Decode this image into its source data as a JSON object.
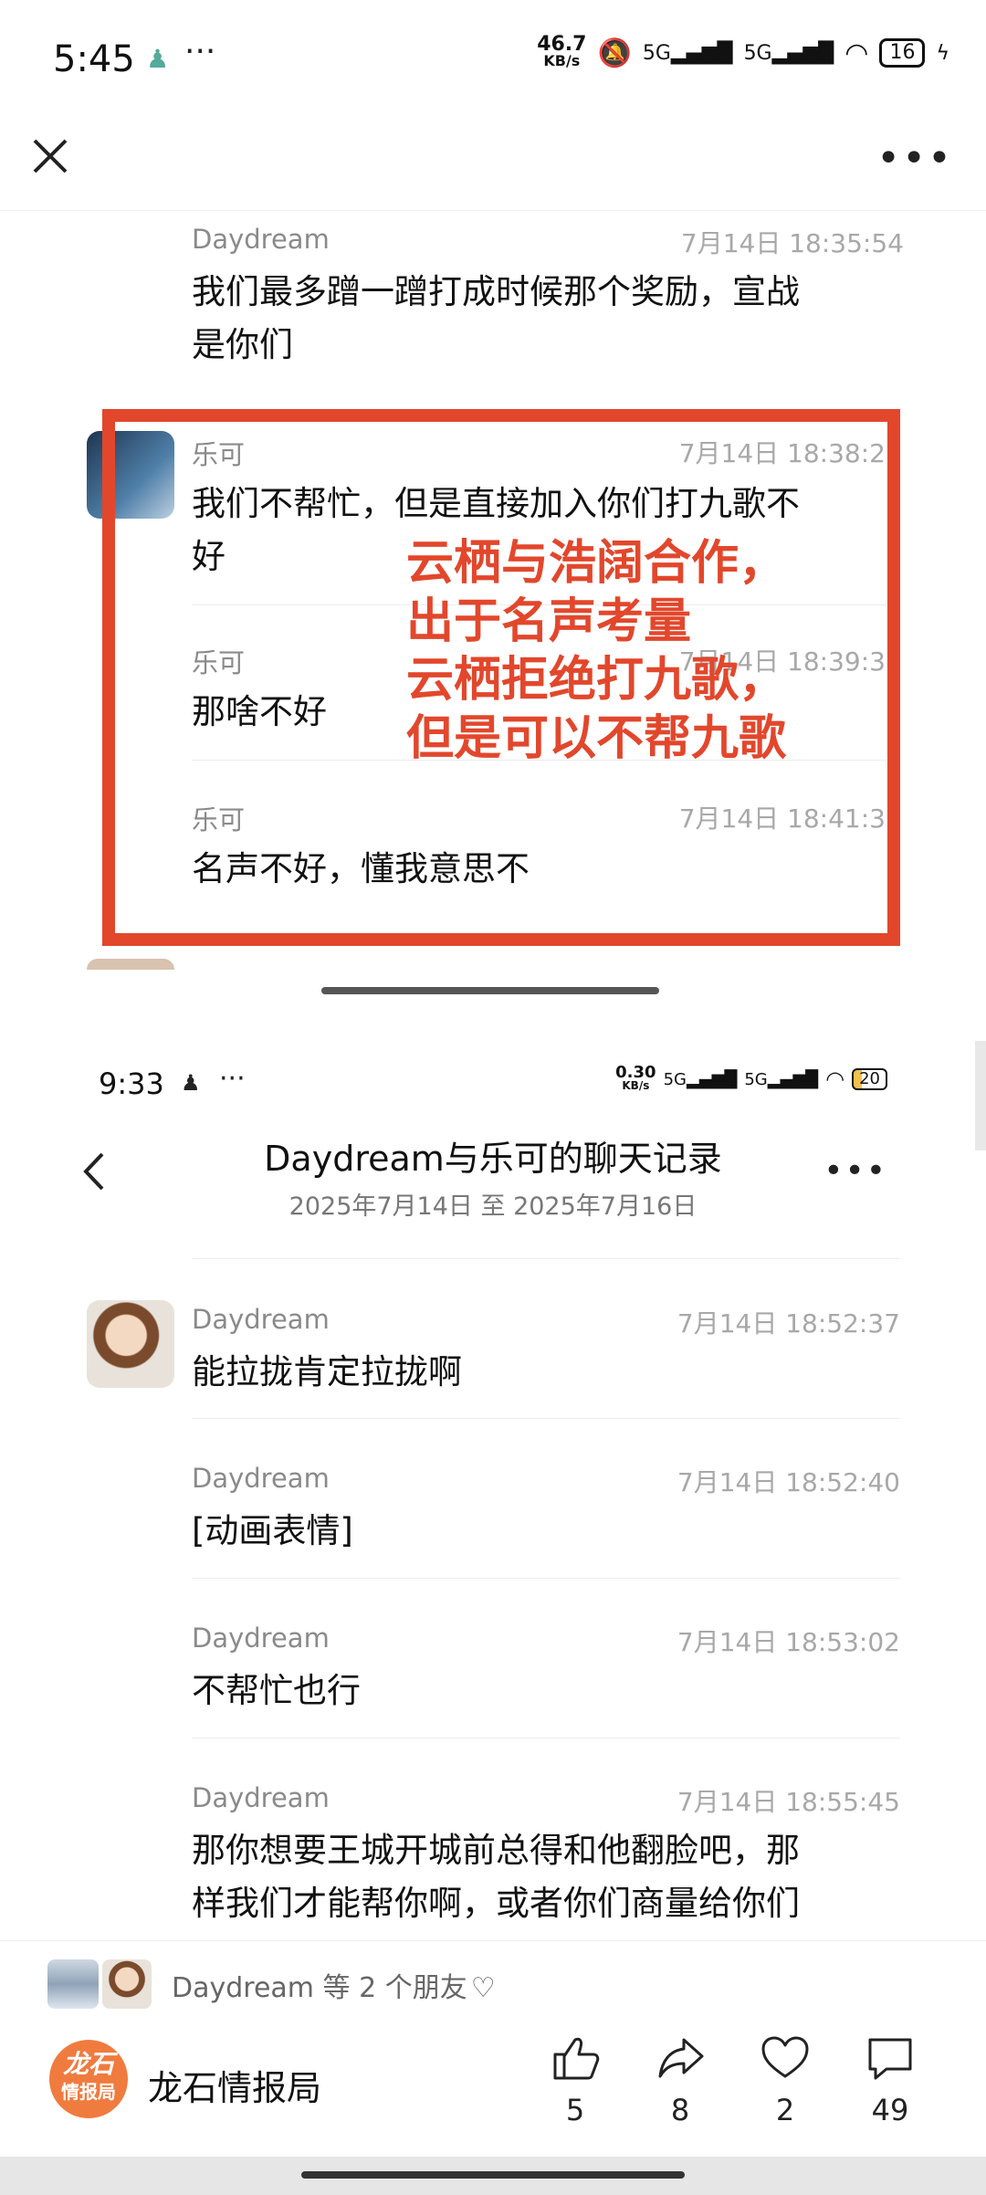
{
  "status1": {
    "time": "5:45",
    "speed_value": "46.7",
    "speed_unit": "KB/s",
    "net1": "5G",
    "net2": "5G",
    "battery": "16"
  },
  "screenshot1": {
    "messages": [
      {
        "name": "Daydream",
        "time": "7月14日 18:35:54",
        "text_l1": "我们最多蹭一蹭打成时候那个奖励，宣战",
        "text_l2": "是你们"
      },
      {
        "name": "乐可",
        "time": "7月14日 18:38:2",
        "text_l1": "我们不帮忙，但是直接加入你们打九歌不",
        "text_l2": "好"
      },
      {
        "name": "乐可",
        "time": "7月14日 18:39:3",
        "text": "那啥不好"
      },
      {
        "name": "乐可",
        "time": "7月14日 18:41:3",
        "text": "名声不好，懂我意思不"
      }
    ],
    "annotation": [
      "云栖与浩阔合作，",
      "出于名声考量",
      "云栖拒绝打九歌，",
      "但是可以不帮九歌"
    ]
  },
  "status2": {
    "time": "9:33",
    "speed_value": "0.30",
    "speed_unit": "KB/s",
    "net1": "5G",
    "net2": "5G",
    "battery": "20"
  },
  "chat": {
    "title": "Daydream与乐可的聊天记录",
    "subtitle": "2025年7月14日 至 2025年7月16日",
    "messages": [
      {
        "name": "Daydream",
        "time": "7月14日 18:52:37",
        "text": "能拉拢肯定拉拢啊"
      },
      {
        "name": "Daydream",
        "time": "7月14日 18:52:40",
        "text": "[动画表情]"
      },
      {
        "name": "Daydream",
        "time": "7月14日 18:53:02",
        "text": "不帮忙也行"
      },
      {
        "name": "Daydream",
        "time": "7月14日 18:55:45",
        "text_l1": "那你想要王城开城前总得和他翻脸吧，那",
        "text_l2": "样我们才能帮你啊，或者你们商量给你们"
      }
    ]
  },
  "footer": {
    "likes_text": "Daydream 等 2 个朋友",
    "account_name": "龙石情报局",
    "logo_l1": "龙石",
    "logo_l2": "情报局",
    "actions": [
      {
        "icon": "thumbs-up-icon",
        "count": "5"
      },
      {
        "icon": "share-icon",
        "count": "8"
      },
      {
        "icon": "heart-icon",
        "count": "2"
      },
      {
        "icon": "comment-icon",
        "count": "49"
      }
    ]
  },
  "colors": {
    "accent_red": "#e2472c",
    "logo_orange": "#f07b3f"
  }
}
